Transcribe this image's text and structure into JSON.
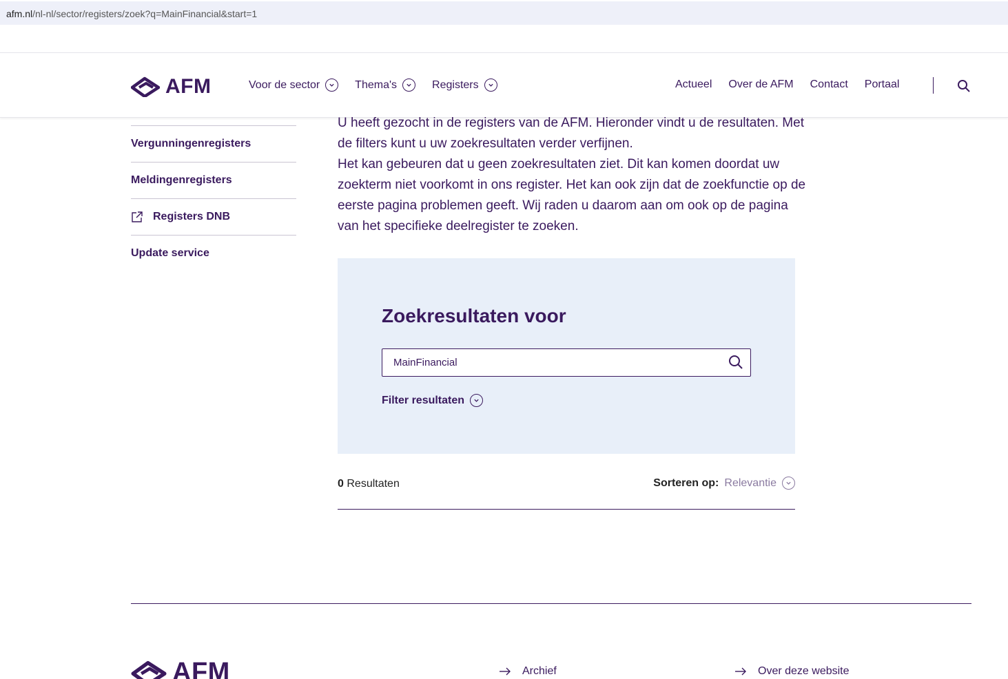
{
  "browser": {
    "url_host": "afm.nl",
    "url_path": "/nl-nl/sector/registers/zoek?q=MainFinancial&start=1"
  },
  "header": {
    "logo_text": "AFM",
    "nav_left": [
      {
        "label": "Voor de sector"
      },
      {
        "label": "Thema's"
      },
      {
        "label": "Registers"
      }
    ],
    "nav_right": [
      {
        "label": "Actueel"
      },
      {
        "label": "Over de AFM"
      },
      {
        "label": "Contact"
      },
      {
        "label": "Portaal"
      }
    ]
  },
  "sidebar": {
    "items": [
      {
        "label": "Vergunningenregisters"
      },
      {
        "label": "Meldingenregisters"
      },
      {
        "label": "Registers DNB",
        "icon": "external-link-icon"
      },
      {
        "label": "Update service"
      }
    ]
  },
  "intro": {
    "paragraph_1": "U heeft gezocht in de registers van de AFM. Hieronder vindt u de resultaten. Met de filters kunt u uw zoekresultaten verder verfijnen.",
    "paragraph_2": "Het kan gebeuren dat u geen zoekresultaten ziet. Dit kan komen doordat uw zoekterm niet voorkomt in ons register. Het kan ook zijn dat de zoekfunctie op de eerste pagina problemen geeft. Wij raden u daarom aan om ook op de pagina van het specifieke deelregister te zoeken."
  },
  "search": {
    "title": "Zoekresultaten voor",
    "query": "MainFinancial",
    "filter_label": "Filter resultaten"
  },
  "results": {
    "count": "0",
    "count_label": "Resultaten",
    "sort_label": "Sorteren op:",
    "sort_value": "Relevantie"
  },
  "footer": {
    "logo_text": "AFM",
    "links": [
      {
        "label": "Archief"
      },
      {
        "label": "Over deze website"
      }
    ]
  },
  "colors": {
    "brand_purple": "#3a1a5e",
    "panel_bg": "#e8eff9",
    "muted": "#8a7aa0"
  }
}
